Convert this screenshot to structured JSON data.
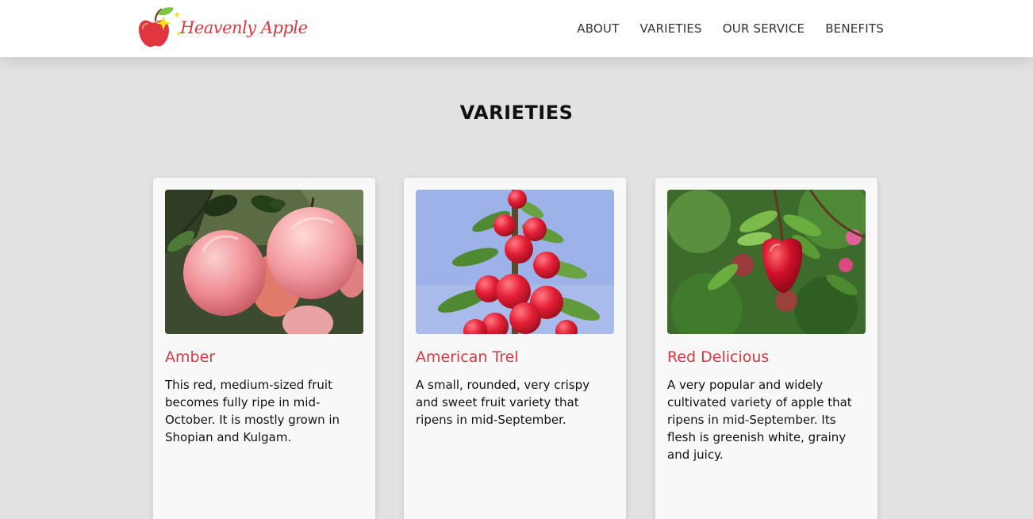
{
  "brand": {
    "name": "Heavenly Apple",
    "logo_icon": "apple-sparkle-icon",
    "colors": {
      "red": "#e0363f",
      "leaf": "#7cc243",
      "sparkle": "#f5e21c"
    }
  },
  "nav": {
    "items": [
      {
        "label": "ABOUT"
      },
      {
        "label": "VARIETIES"
      },
      {
        "label": "OUR SERVICE"
      },
      {
        "label": "BENEFITS"
      }
    ]
  },
  "section": {
    "title": "VARIETIES"
  },
  "cards": [
    {
      "title": "Amber",
      "description": "This red, medium-sized fruit becomes fully ripe in mid-October. It is mostly grown in Shopian and Kulgam."
    },
    {
      "title": "American Trel",
      "description": "A small, rounded, very crispy and sweet fruit variety that ripens in mid-September."
    },
    {
      "title": "Red Delicious",
      "description": "A very popular and widely cultivated variety of apple that ripens in mid-September. Its flesh is greenish white, grainy and juicy."
    }
  ],
  "theme": {
    "accent": "#d83a3f",
    "page_bg": "#e2e2e2",
    "card_bg": "#f8f8f8"
  }
}
